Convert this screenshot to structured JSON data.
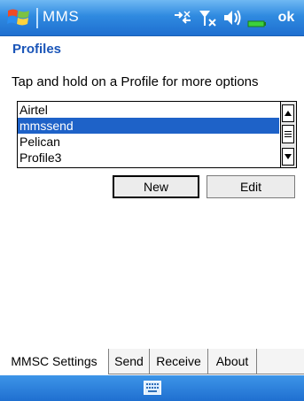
{
  "titlebar": {
    "app_title": "MMS",
    "ok_label": "ok",
    "icons": [
      "windows-start-icon",
      "connectivity-icon",
      "signal-icon",
      "volume-icon",
      "battery-icon"
    ]
  },
  "page": {
    "title": "Profiles",
    "instruction": "Tap and hold on a Profile for more options"
  },
  "profiles": {
    "items": [
      "Airtel",
      "mmssend",
      "Pelican",
      "Profile3"
    ],
    "selected": "mmssend"
  },
  "buttons": {
    "new_label": "New",
    "edit_label": "Edit"
  },
  "tabs": [
    {
      "label": "MMSC Settings",
      "active": true
    },
    {
      "label": "Send",
      "active": false
    },
    {
      "label": "Receive",
      "active": false
    },
    {
      "label": "About",
      "active": false
    }
  ],
  "menubar": {
    "icon": "keyboard-icon"
  },
  "colors": {
    "titlebar": "#2f8ae0",
    "selection": "#1e62c8",
    "page_title": "#1a55b8"
  }
}
